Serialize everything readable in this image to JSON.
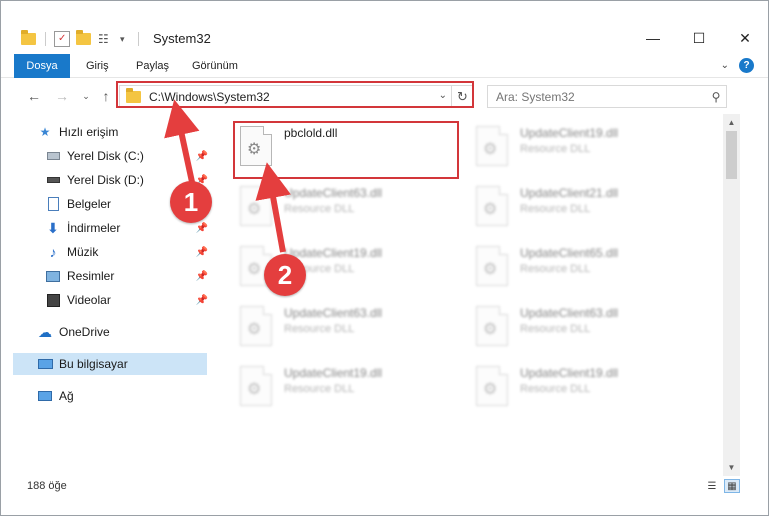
{
  "window": {
    "title": "System32",
    "controls": {
      "minimize": "—",
      "maximize": "☐",
      "close": "✕"
    }
  },
  "ribbon": {
    "tabs": [
      "Dosya",
      "Giriş",
      "Paylaş",
      "Görünüm"
    ],
    "help": "?"
  },
  "address": {
    "path": "C:\\Windows\\System32",
    "search_placeholder": "Ara: System32"
  },
  "sidebar": {
    "items": [
      {
        "label": "Hızlı erişim",
        "icon": "star-icon"
      },
      {
        "label": "Yerel Disk (C:)",
        "icon": "drive-icon",
        "pinned": true
      },
      {
        "label": "Yerel Disk (D:)",
        "icon": "drive-icon",
        "pinned": true
      },
      {
        "label": "Belgeler",
        "icon": "documents-icon",
        "pinned": true
      },
      {
        "label": "İndirmeler",
        "icon": "download-icon",
        "pinned": true
      },
      {
        "label": "Müzik",
        "icon": "music-icon",
        "pinned": true
      },
      {
        "label": "Resimler",
        "icon": "pictures-icon",
        "pinned": true
      },
      {
        "label": "Videolar",
        "icon": "videos-icon",
        "pinned": true
      },
      {
        "label": "OneDrive",
        "icon": "cloud-icon"
      },
      {
        "label": "Bu bilgisayar",
        "icon": "computer-icon",
        "selected": true
      },
      {
        "label": "Ağ",
        "icon": "network-icon"
      }
    ]
  },
  "files": [
    {
      "name": "pbclold.dll",
      "type": ""
    },
    {
      "name": "UpdateClient19.dll",
      "type": "Resource DLL"
    },
    {
      "name": "UpdateClient63.dll",
      "type": "Resource DLL"
    },
    {
      "name": "UpdateClient21.dll",
      "type": "Resource DLL"
    },
    {
      "name": "UpdateClient19.dll",
      "type": "Resource DLL"
    },
    {
      "name": "UpdateClient65.dll",
      "type": "Resource DLL"
    },
    {
      "name": "UpdateClient63.dll",
      "type": "Resource DLL"
    },
    {
      "name": "UpdateClient63.dll",
      "type": "Resource DLL"
    },
    {
      "name": "UpdateClient19.dll",
      "type": "Resource DLL"
    },
    {
      "name": "UpdateClient19.dll",
      "type": "Resource DLL"
    }
  ],
  "status": {
    "count": "188 öğe"
  },
  "annotations": {
    "step1": "1",
    "step2": "2",
    "color": "#e43e3e"
  }
}
